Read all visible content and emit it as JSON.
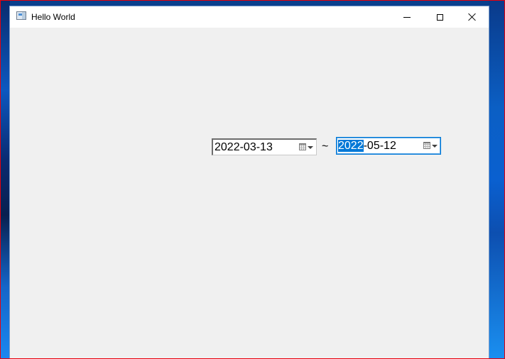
{
  "window": {
    "title": "Hello World",
    "minimize_glyph": "minimize-icon",
    "maximize_glyph": "maximize-icon",
    "close_glyph": "close-icon"
  },
  "date_range": {
    "start": {
      "year": "2022",
      "rest": "-03-13"
    },
    "separator": "~",
    "end": {
      "year": "2022",
      "rest": "-05-12",
      "selected_segment": "year"
    }
  },
  "colors": {
    "selection": "#0078d7",
    "client_background": "#f0f0f0",
    "outer_border": "#e8000b"
  }
}
